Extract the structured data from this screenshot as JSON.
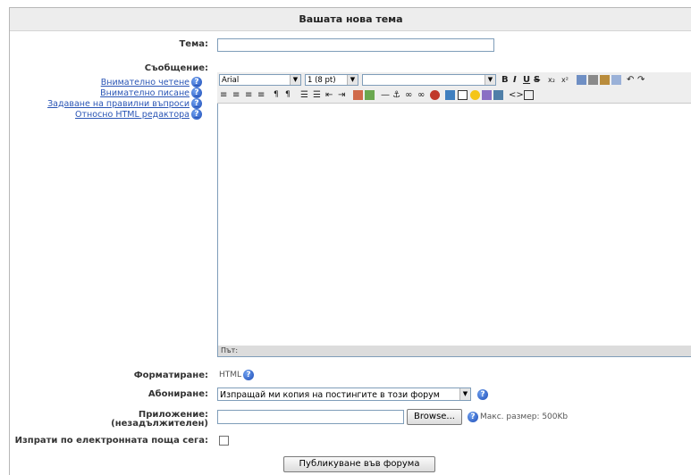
{
  "form": {
    "title": "Вашата нова тема",
    "subject_label": "Тема:",
    "subject_value": "",
    "message_label": "Съобщение:",
    "help_links": [
      "Внимателно четене",
      "Внимателно писане",
      "Задаване на правилни въпроси",
      "Относно HTML редактора"
    ],
    "editor": {
      "font_family": "Arial",
      "font_size": "1 (8 pt)",
      "style_value": "",
      "message_value": "",
      "path_label": "Път:"
    },
    "format_label": "Форматиране:",
    "format_value": "HTML",
    "subscription_label": "Абониране:",
    "subscription_value": "Изпращай ми копия на постингите в този форум",
    "attachment_label_1": "Приложение:",
    "attachment_label_2": "(незадължителен)",
    "browse_label": "Browse...",
    "max_size": "Макс. размер: 500Kb",
    "email_now_label": "Изпрати по електронната поща сега:",
    "email_now_checked": false,
    "submit_label": "Публикуване във форума",
    "help_glyph": "?"
  },
  "colors": {
    "link": "#2a55b5",
    "help_icon": "#1c4bb6",
    "header_bg": "#ededed"
  }
}
